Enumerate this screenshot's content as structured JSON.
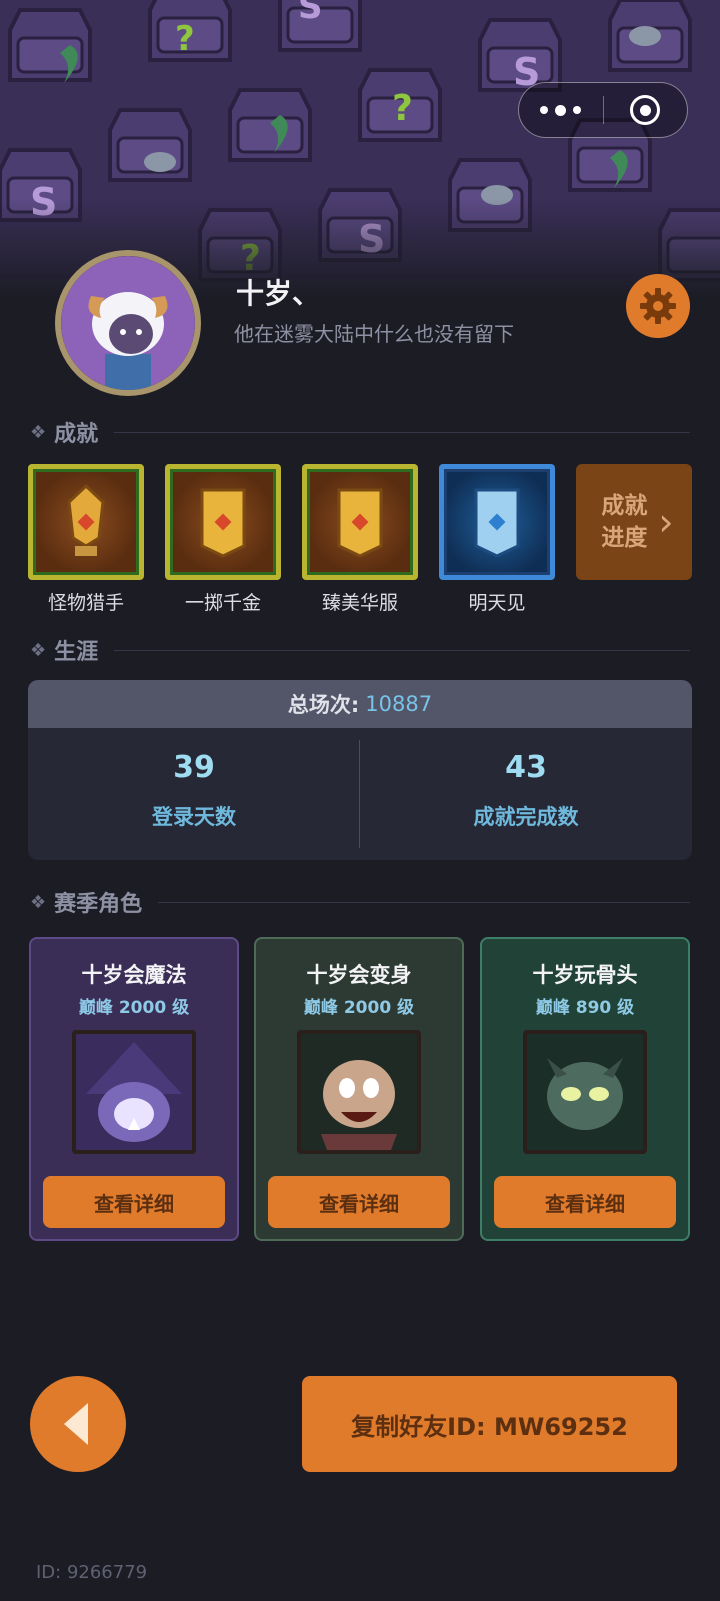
{
  "profile": {
    "username": "十岁、",
    "bio": "他在迷雾大陆中什么也没有留下"
  },
  "capsule": {
    "more_icon": "more-dots-icon",
    "close_icon": "target-icon"
  },
  "settings_icon": "gear-icon",
  "sections": {
    "achievements": "成就",
    "career": "生涯",
    "season_characters": "赛季角色"
  },
  "achievements": [
    {
      "label": "怪物猎手",
      "style": "gold"
    },
    {
      "label": "一掷千金",
      "style": "gold"
    },
    {
      "label": "臻美华服",
      "style": "gold"
    },
    {
      "label": "明天见",
      "style": "blue"
    }
  ],
  "achievement_progress": {
    "line1": "成就",
    "line2": "进度",
    "chevron": "›"
  },
  "career": {
    "total_label": "总场次:",
    "total_value": "10887",
    "stats": [
      {
        "value": "39",
        "label": "登录天数"
      },
      {
        "value": "43",
        "label": "成就完成数"
      }
    ]
  },
  "characters": [
    {
      "name": "十岁会魔法",
      "level": "巅峰 2000 级",
      "button": "查看详细",
      "theme": "purple"
    },
    {
      "name": "十岁会变身",
      "level": "巅峰 2000 级",
      "button": "查看详细",
      "theme": "green-dark"
    },
    {
      "name": "十岁玩骨头",
      "level": "巅峰 890 级",
      "button": "查看详细",
      "theme": "teal"
    }
  ],
  "footer": {
    "copy_button": "复制好友ID: MW69252",
    "user_id": "ID: 9266779"
  },
  "colors": {
    "accent": "#e07b2c",
    "stat_value": "#9fdcf2",
    "background": "#1b1c24"
  }
}
